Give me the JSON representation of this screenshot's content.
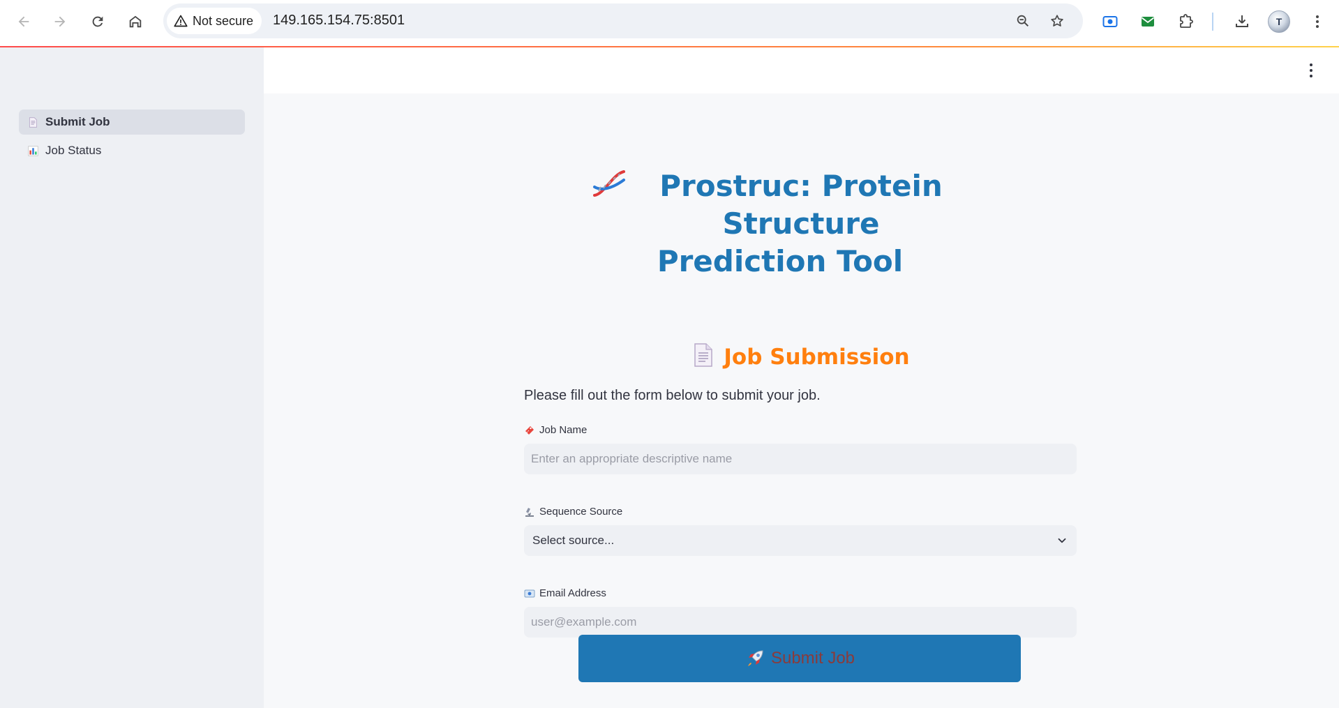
{
  "browser": {
    "security_label": "Not secure",
    "url": "149.165.154.75:8501",
    "icons": [
      "back-arrow-icon",
      "forward-arrow-icon",
      "reload-icon",
      "home-icon",
      "warning-icon",
      "zoom-icon",
      "star-icon",
      "screencast-extension-icon",
      "mail-extension-icon",
      "extensions-icon",
      "download-icon",
      "profile-avatar",
      "more-menu-icon"
    ],
    "avatar_text": "T"
  },
  "sidebar": {
    "items": [
      {
        "label": "Submit Job",
        "icon": "document-icon",
        "active": true
      },
      {
        "label": "Job Status",
        "icon": "bar-chart-icon",
        "active": false
      }
    ]
  },
  "main": {
    "title_line1": "Prostruc: Protein Structure",
    "title_line2": "Prediction Tool",
    "title_icon": "dna-icon",
    "section_title": "Job Submission",
    "section_icon": "document-icon",
    "intro": "Please fill out the form below to submit your job.",
    "form": {
      "job_name": {
        "label": "Job Name",
        "icon": "ticket-icon",
        "placeholder": "Enter an appropriate descriptive name",
        "value": ""
      },
      "sequence_source": {
        "label": "Sequence Source",
        "icon": "microscope-icon",
        "selected": "Select source..."
      },
      "email": {
        "label": "Email Address",
        "icon": "envelope-icon",
        "placeholder": "user@example.com",
        "value": ""
      }
    },
    "submit_label": "Submit Job",
    "submit_icon": "rocket-icon"
  },
  "colors": {
    "title": "#1f77b4",
    "section_title": "#ff7f0e",
    "button": "#1f77b4",
    "sidebar_bg": "#eef0f4",
    "main_bg": "#f7f8fa"
  }
}
